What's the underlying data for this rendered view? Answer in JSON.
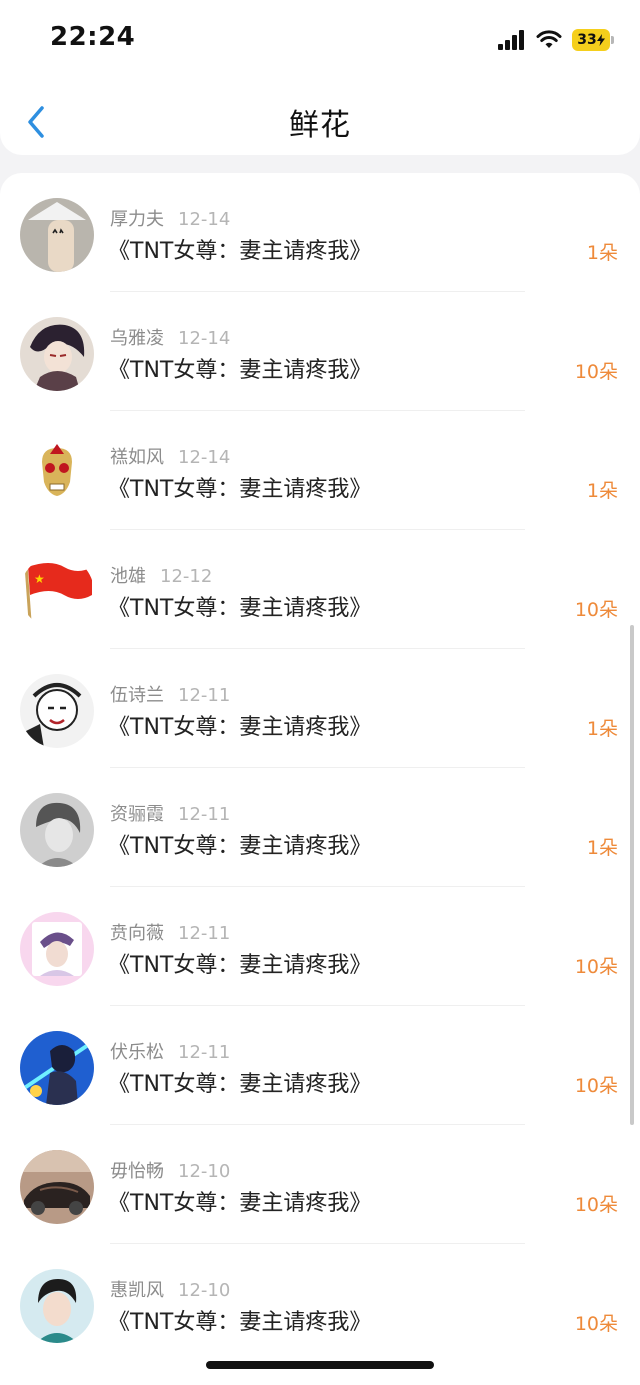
{
  "status": {
    "time": "22:24",
    "battery": "33"
  },
  "nav": {
    "title": "鲜花",
    "back_icon": "chevron-left-icon"
  },
  "colors": {
    "accent": "#2e8fe0",
    "count": "#ee8a3a",
    "meta": "#8c8c8c"
  },
  "rows": [
    {
      "name": "厚力夫",
      "date": "12-14",
      "book": "《TNT女尊：妻主请疼我》",
      "count": "1朵"
    },
    {
      "name": "乌雅凌",
      "date": "12-14",
      "book": "《TNT女尊：妻主请疼我》",
      "count": "10朵"
    },
    {
      "name": "禚如风",
      "date": "12-14",
      "book": "《TNT女尊：妻主请疼我》",
      "count": "1朵"
    },
    {
      "name": "池雄",
      "date": "12-12",
      "book": "《TNT女尊：妻主请疼我》",
      "count": "10朵"
    },
    {
      "name": "伍诗兰",
      "date": "12-11",
      "book": "《TNT女尊：妻主请疼我》",
      "count": "1朵"
    },
    {
      "name": "资骊霞",
      "date": "12-11",
      "book": "《TNT女尊：妻主请疼我》",
      "count": "1朵"
    },
    {
      "name": "贲向薇",
      "date": "12-11",
      "book": "《TNT女尊：妻主请疼我》",
      "count": "10朵"
    },
    {
      "name": "伏乐松",
      "date": "12-11",
      "book": "《TNT女尊：妻主请疼我》",
      "count": "10朵"
    },
    {
      "name": "毋怡畅",
      "date": "12-10",
      "book": "《TNT女尊：妻主请疼我》",
      "count": "10朵"
    },
    {
      "name": "惠凯风",
      "date": "12-10",
      "book": "《TNT女尊：妻主请疼我》",
      "count": "10朵"
    }
  ]
}
